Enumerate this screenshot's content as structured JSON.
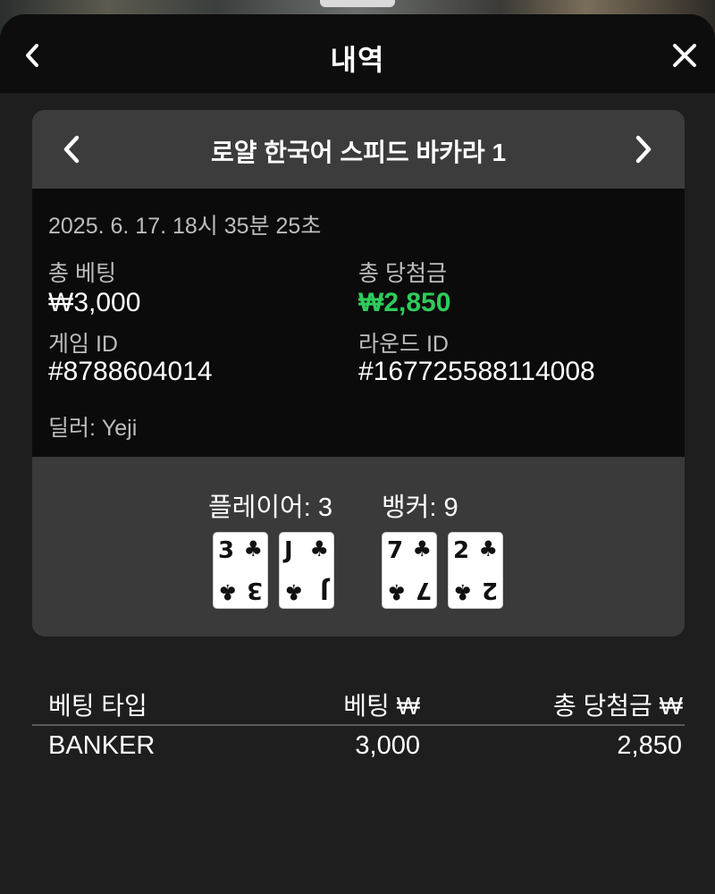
{
  "header": {
    "title": "내역",
    "back_icon": "chevron-left-icon",
    "close_icon": "close-icon"
  },
  "game": {
    "name": "로얄 한국어 스피드 바카라 1",
    "prev_icon": "chevron-left-icon",
    "next_icon": "chevron-right-icon"
  },
  "details": {
    "datetime": "2025. 6. 17. 18시 35분 25초",
    "total_bet_label": "총 베팅",
    "total_bet_value": "₩3,000",
    "total_win_label": "총 당첨금",
    "total_win_value": "₩2,850",
    "game_id_label": "게임 ID",
    "game_id_value": "#8788604014",
    "round_id_label": "라운드 ID",
    "round_id_value": "#167725588114008",
    "dealer": "딜러: Yeji"
  },
  "result": {
    "player_label": "플레이어: 3",
    "banker_label": "뱅커: 9",
    "player_cards": [
      {
        "rank": "3",
        "suit": "♣"
      },
      {
        "rank": "J",
        "suit": "♣"
      }
    ],
    "banker_cards": [
      {
        "rank": "7",
        "suit": "♣"
      },
      {
        "rank": "2",
        "suit": "♣"
      }
    ]
  },
  "table": {
    "columns": [
      "베팅 타입",
      "베팅 ₩",
      "총 당첨금 ₩"
    ],
    "rows": [
      {
        "type": "BANKER",
        "bet": "3,000",
        "win": "2,850"
      }
    ]
  },
  "colors": {
    "win_green": "#2ecc5b",
    "header_bg": "#0d0d0d",
    "card_bg": "#3a3a3a"
  }
}
